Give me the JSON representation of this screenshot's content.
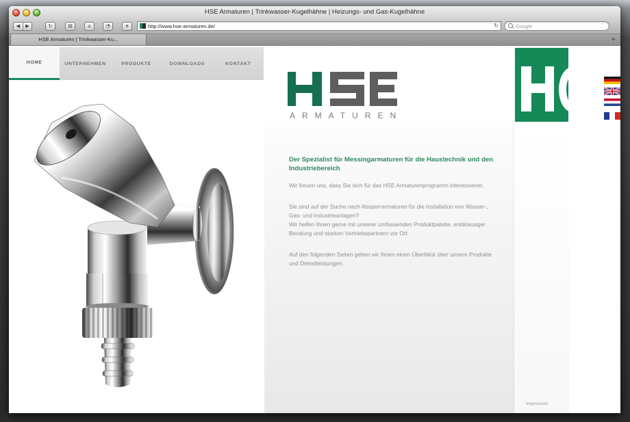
{
  "window": {
    "title": "HSE Armaturen | Trinkwasser-Kugelhähne | Heizungs- und Gas-Kugelhähne"
  },
  "toolbar": {
    "url": "http://www.hse-armaturen.de/",
    "search_placeholder": "Google",
    "buttons": [
      "back-icon",
      "forward-icon",
      "reload-icon",
      "bookmarks-icon",
      "home-icon",
      "history-icon",
      "add-bookmark-icon"
    ]
  },
  "tabs": [
    {
      "label": "HSE Armaturen | Trinkwasser-Ku...",
      "active": true
    }
  ],
  "nav": {
    "items": [
      {
        "label": "HOME",
        "active": true
      },
      {
        "label": "UNTERNEHMEN",
        "active": false
      },
      {
        "label": "PRODUKTE",
        "active": false
      },
      {
        "label": "DOWNLOADS",
        "active": false
      },
      {
        "label": "KONTAKT",
        "active": false
      }
    ]
  },
  "logo": {
    "mark": "HSE",
    "subtitle": "ARMATUREN"
  },
  "content": {
    "heading": "Der Spezialist für Messingarmaturen für die Haustechnik und den Industriebereich",
    "paragraphs": [
      "Wir freuen uns, dass Sie sich für das HSE Armaturenprogramm interessieren.",
      "Sie sind auf der Suche nach Absperrarmaturen für die Installation von Wasser-, Gas- und Industrieanlagen?",
      "Wir helfen Ihnen gerne mit unserer umfassenden Produktpalette, erstklassiger Beratung und starken Vertriebspartnern vor Ort.",
      "Auf den folgenden Seiten geben wir Ihnen einen Überblick über unsere Produkte und Dienstleistungen."
    ]
  },
  "footer": {
    "impressum": "Impressum"
  },
  "language_flags": [
    "german-flag-icon",
    "uk-flag-icon",
    "dutch-flag-icon",
    "french-flag-icon"
  ],
  "colors": {
    "brand_green": "#178a5e",
    "heading_green": "#2a8a5c",
    "logo_gray": "#5e5e5e",
    "nav_bg": "#d8d8d8",
    "body_text": "#8e8e8e"
  }
}
